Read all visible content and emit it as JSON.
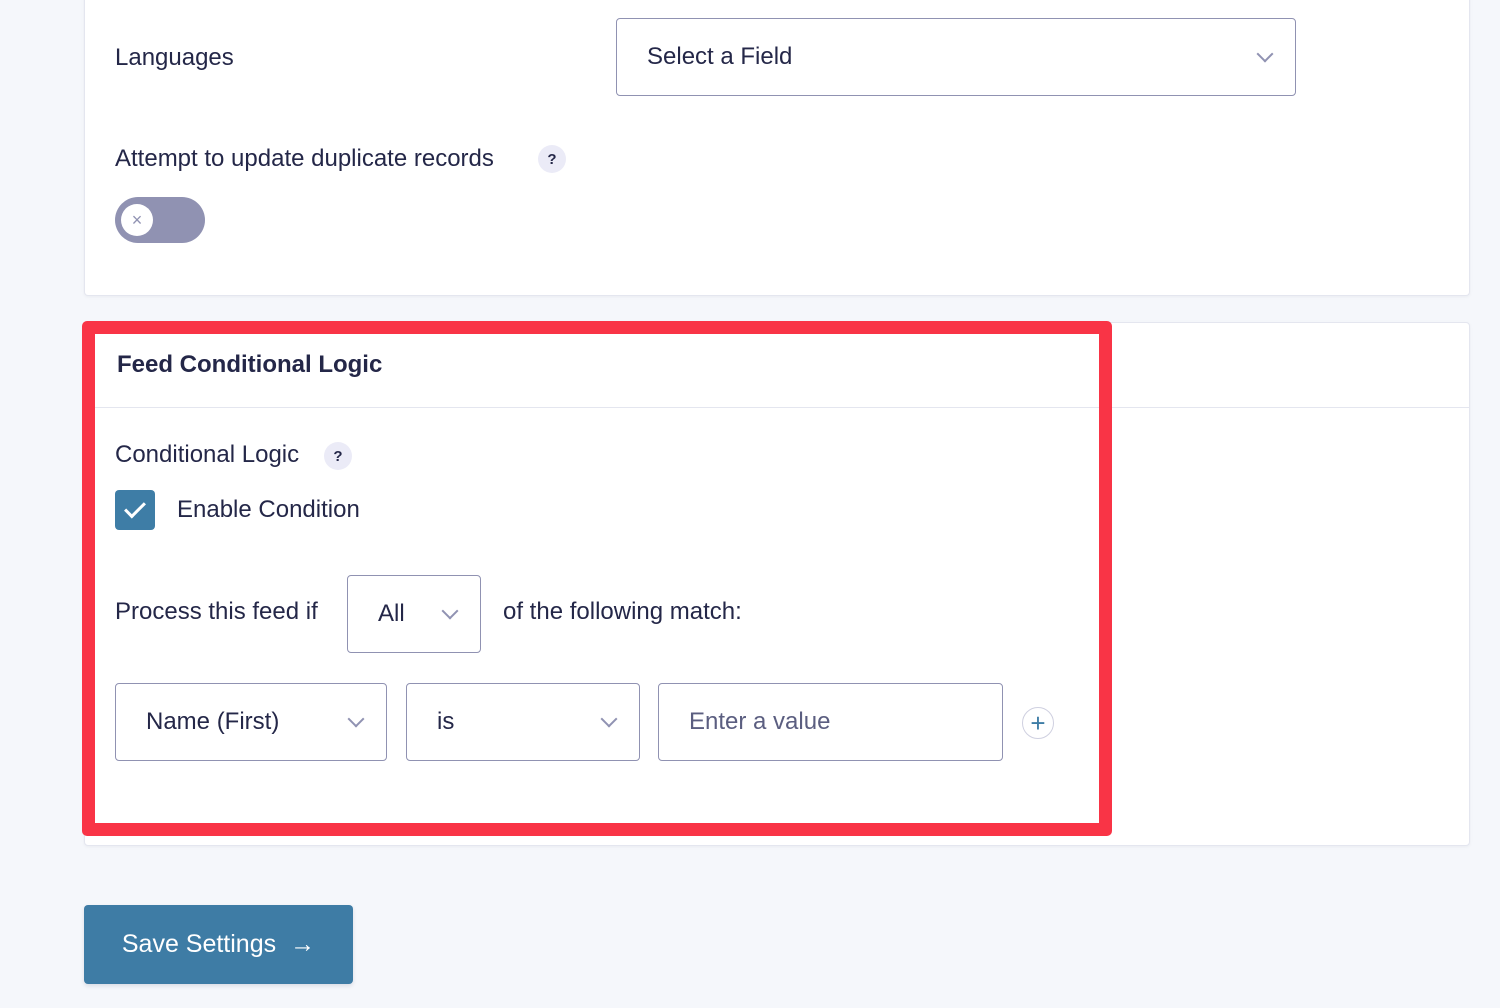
{
  "mapping": {
    "languages_label": "Languages",
    "languages_select_value": "Select a Field",
    "duplicate_label": "Attempt to update duplicate records",
    "duplicate_help": "?",
    "duplicate_toggle_state": "off",
    "toggle_off_glyph": "×"
  },
  "conditional_logic": {
    "section_title": "Feed Conditional Logic",
    "field_label": "Conditional Logic",
    "help": "?",
    "enable_label": "Enable Condition",
    "enable_checked": true,
    "process_prefix": "Process this feed if",
    "match_type": "All",
    "process_suffix": "of the following match:",
    "rule": {
      "field": "Name (First)",
      "operator": "is",
      "value": "",
      "value_placeholder": "Enter a value"
    },
    "add_rule_glyph": "+"
  },
  "footer": {
    "save_label": "Save Settings",
    "save_arrow": "→"
  },
  "colors": {
    "accent": "#3e7ca5",
    "highlight": "#f93446",
    "toggle_off": "#9092b2",
    "background": "#f5f7fb"
  }
}
